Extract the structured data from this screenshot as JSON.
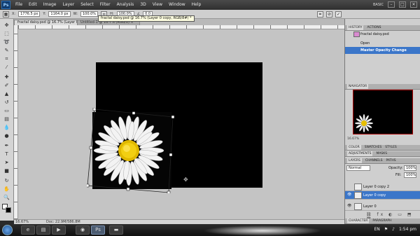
{
  "app": {
    "logo": "Ps",
    "menu": [
      "File",
      "Edit",
      "Image",
      "Layer",
      "Select",
      "Filter",
      "Analysis",
      "3D",
      "View",
      "Window",
      "Help"
    ],
    "workspace": "BASIC",
    "min": "–",
    "max": "□",
    "close": "✕"
  },
  "options": {
    "x": "1776.5 px",
    "y": "1164.0 px",
    "w": "100.0%",
    "h": "100.0%",
    "angle": "0.0",
    "x_label": "X:",
    "y_label": "Y:",
    "w_label": "W:",
    "h_label": "H:",
    "angle_label": "∠",
    "cancel": "⊘",
    "commit": "✓"
  },
  "tooltip": "fractal daisy.psd @ 16.7% (Layer 0 copy, RGB/8#) *",
  "tabs": {
    "active": "fractal daisy.psd @ 16.7% (Layer 0 copy, RGB/8#)  ×",
    "inactive": "Untitled-1 @ 16.7% (RGB/8)  ×"
  },
  "status": {
    "zoom": "16.67%",
    "doc": "Doc: 22.9M/586.8M"
  },
  "history": {
    "tabs": [
      "HISTORY",
      "ACTIONS"
    ],
    "snapshot": "fractal daisy.psd",
    "items": [
      "Open",
      "Master Opacity Change"
    ]
  },
  "navigator": {
    "tabs": [
      "NAVIGATOR"
    ],
    "zoom": "16.67%"
  },
  "color": {
    "tabs": [
      "COLOR",
      "SWATCHES",
      "STYLES"
    ]
  },
  "adjust": {
    "tabs": [
      "ADJUSTMENTS",
      "MASKS"
    ]
  },
  "layers": {
    "tabs": [
      "LAYERS",
      "CHANNELS",
      "PATHS"
    ],
    "blend": "Normal",
    "opacity_label": "Opacity:",
    "opacity": "100%",
    "fill_label": "Fill:",
    "fill": "100%",
    "items": [
      "Layer 0 copy 2",
      "Layer 0 copy",
      "Layer 0"
    ]
  },
  "bottom_tabs": [
    "CHARACTER",
    "PARAGRAPH"
  ],
  "taskbar": {
    "lang": "EN",
    "time": "1:54 pm"
  },
  "colors": {
    "accent": "#3b76c9",
    "canvas": "#000000",
    "pasteboard": "#c4c4c4"
  }
}
